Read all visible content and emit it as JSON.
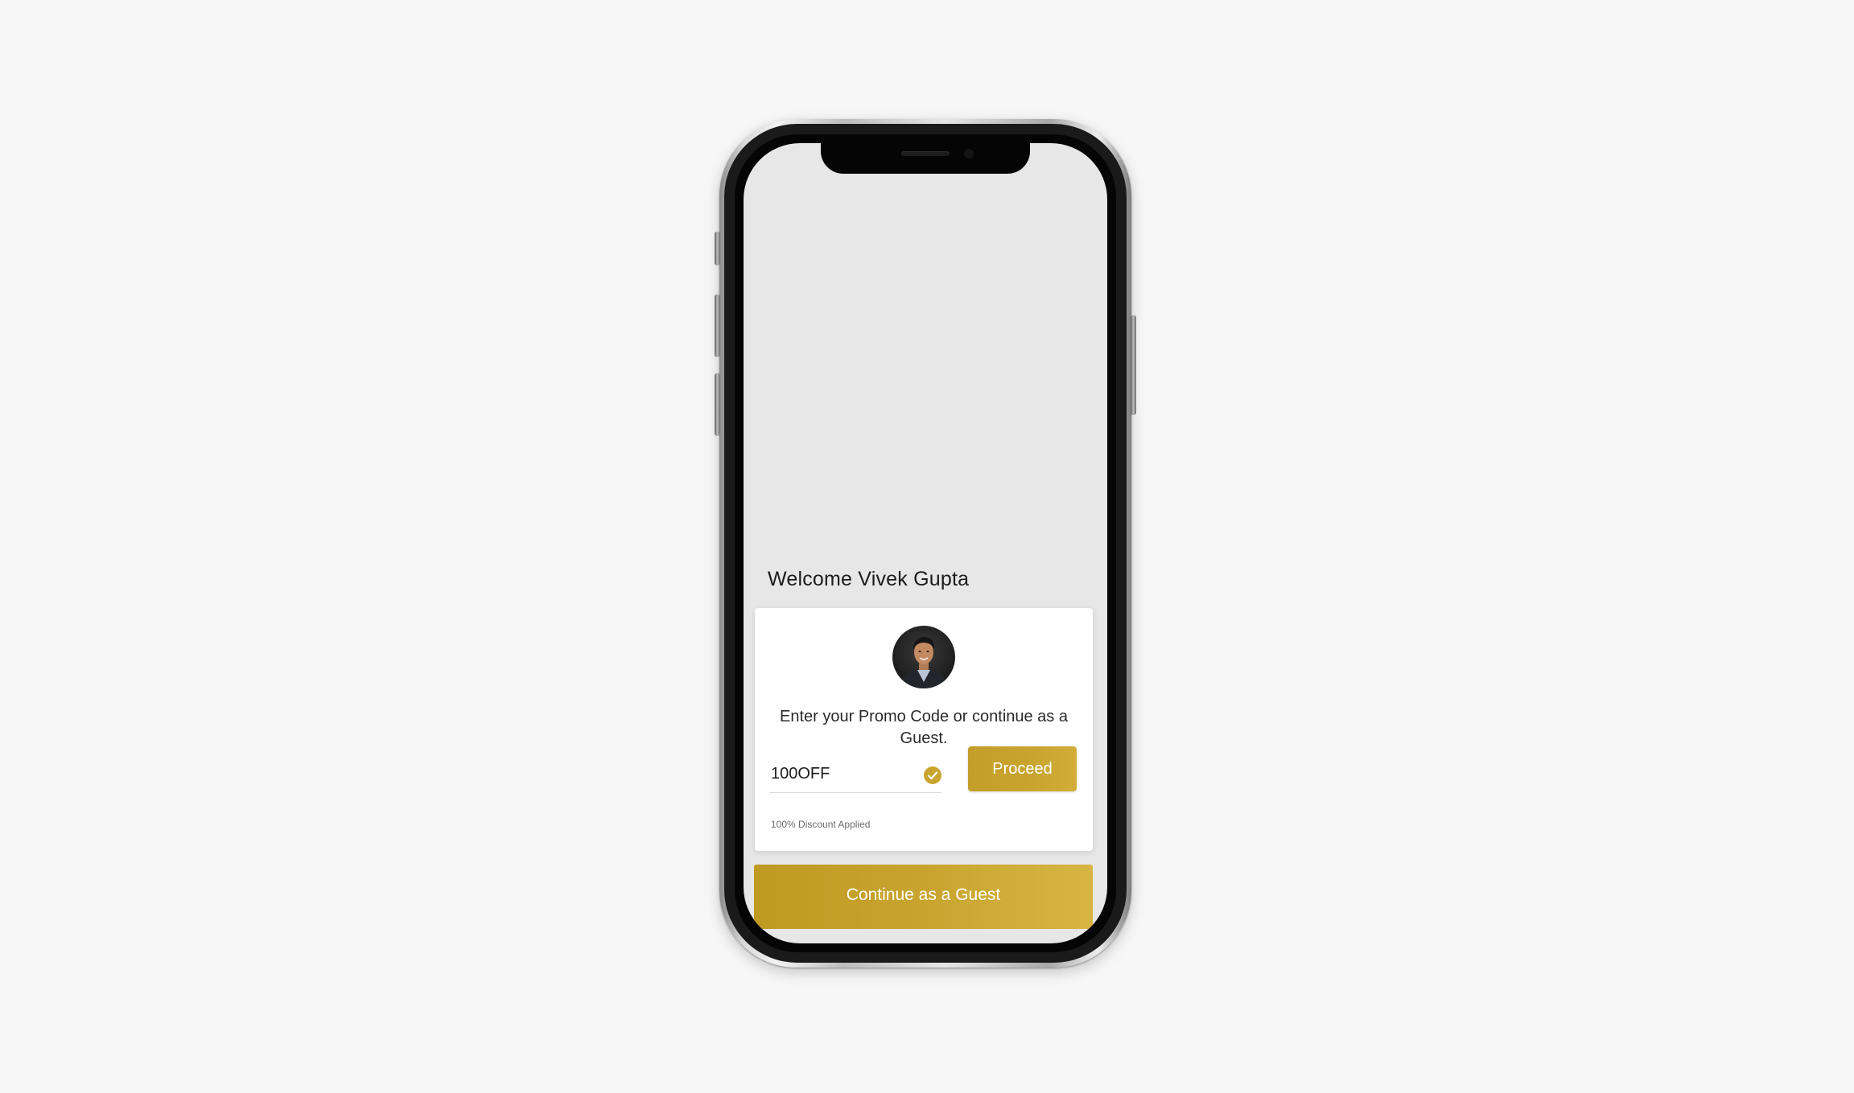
{
  "screen": {
    "welcome_text": "Welcome Vivek Gupta"
  },
  "card": {
    "avatar_icon": "user-avatar-photo",
    "prompt": "Enter your Promo Code or continue as a Guest.",
    "promo_input": {
      "value": "100OFF",
      "placeholder": ""
    },
    "status_icon": "check-circle-icon",
    "proceed_label": "Proceed",
    "discount_note": "100% Discount Applied"
  },
  "guest_button_label": "Continue as a Guest",
  "colors": {
    "accent": "#c9a530",
    "accent_light": "#d8b443",
    "screen_bg": "#e7e7e7",
    "page_bg": "#f7f7f7",
    "text": "#1c1c1c"
  }
}
